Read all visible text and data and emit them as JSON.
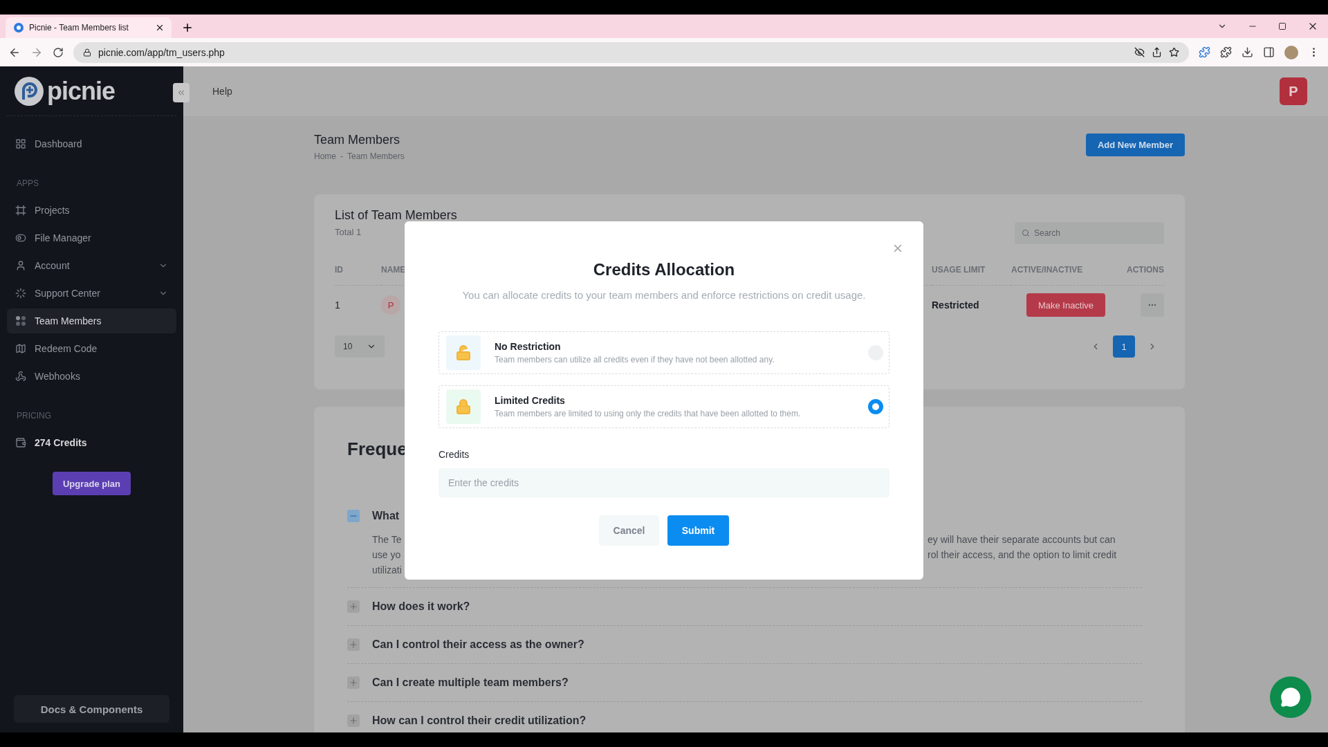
{
  "browser": {
    "tab_title": "Picnie - Team Members list",
    "url": "picnie.com/app/tm_users.php"
  },
  "sidebar": {
    "logo": "picnie",
    "sections": [
      {
        "items": [
          {
            "label": "Dashboard",
            "selected": false,
            "expandable": false
          }
        ]
      },
      {
        "heading": "APPS",
        "items": [
          {
            "label": "Projects",
            "selected": false,
            "expandable": false
          },
          {
            "label": "File Manager",
            "selected": false,
            "expandable": false
          },
          {
            "label": "Account",
            "selected": false,
            "expandable": true
          },
          {
            "label": "Support Center",
            "selected": false,
            "expandable": true
          },
          {
            "label": "Team Members",
            "selected": true,
            "expandable": false
          },
          {
            "label": "Redeem Code",
            "selected": false,
            "expandable": false
          },
          {
            "label": "Webhooks",
            "selected": false,
            "expandable": false
          }
        ]
      },
      {
        "heading": "PRICING",
        "items": [
          {
            "label": "274 Credits",
            "selected": false,
            "expandable": false,
            "bold": true
          }
        ]
      }
    ],
    "upgrade_button": "Upgrade plan",
    "docs_button": "Docs & Components"
  },
  "header": {
    "help": "Help",
    "avatar": "P"
  },
  "page": {
    "title": "Team Members",
    "breadcrumb": [
      "Home",
      "Team Members"
    ],
    "breadcrumb_separator": "-",
    "add_button": "Add New Member"
  },
  "members": {
    "title": "List of Team Members",
    "total": "Total 1",
    "search_placeholder": "Search",
    "columns": [
      "ID",
      "NAME",
      "USAGE LIMIT",
      "ACTIVE/INACTIVE",
      "ACTIONS"
    ],
    "rows": [
      {
        "id": "1",
        "avatar": "P",
        "usage_limit": "Restricted",
        "action": "Make Inactive"
      }
    ],
    "page_size": "10",
    "pages": [
      {
        "label": "1",
        "selected": true
      }
    ]
  },
  "faq": {
    "title": "Freque",
    "items": [
      {
        "question": "What",
        "expanded": true,
        "answer_left": [
          "The Te",
          "use yo",
          "utilizati"
        ],
        "answer_right": [
          "ey will have their separate accounts but can",
          "rol their access, and the option to limit credit"
        ]
      },
      {
        "question": "How does it work?",
        "expanded": false
      },
      {
        "question": "Can I control their access as the owner?",
        "expanded": false
      },
      {
        "question": "Can I create multiple team members?",
        "expanded": false
      },
      {
        "question": "How can I control their credit utilization?",
        "expanded": false
      }
    ]
  },
  "modal": {
    "title": "Credits Allocation",
    "subtitle": "You can allocate credits to your team members and enforce restrictions on credit usage.",
    "options": [
      {
        "kind": "unrestricted",
        "title": "No Restriction",
        "description": "Team members can utilize all credits even if they have not been allotted any.",
        "selected": false
      },
      {
        "kind": "limited",
        "title": "Limited Credits",
        "description": "Team members are limited to using only the credits that have been allotted to them.",
        "selected": true
      }
    ],
    "credits_label": "Credits",
    "credits_placeholder": "Enter the credits",
    "cancel": "Cancel",
    "submit": "Submit"
  }
}
